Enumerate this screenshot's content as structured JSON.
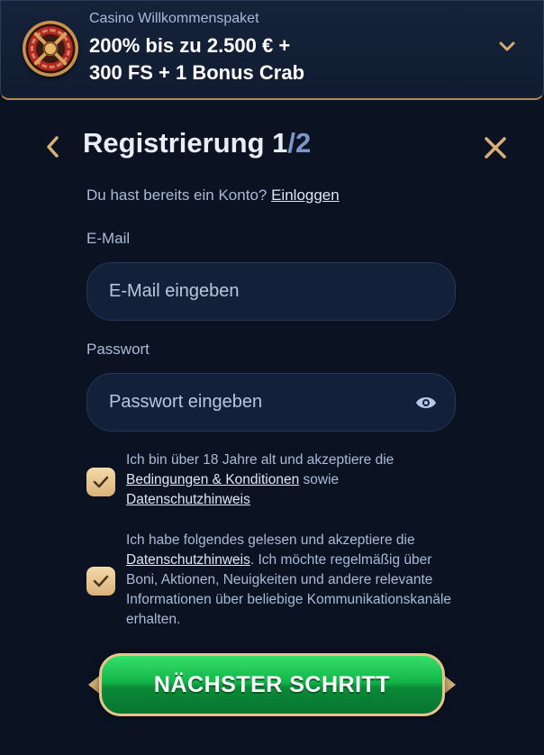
{
  "promo": {
    "kicker": "Casino Willkommenspaket",
    "title_line1": "200% bis zu 2.500 € +",
    "title_line2": "300 FS + 1 Bonus Crab"
  },
  "header": {
    "title": "Registrierung 1",
    "step_separator": "/",
    "step_total": "2"
  },
  "login": {
    "text": "Du hast bereits ein Konto?",
    "link": "Einloggen"
  },
  "email": {
    "label": "E-Mail",
    "placeholder": "E-Mail eingeben",
    "value": ""
  },
  "password": {
    "label": "Passwort",
    "placeholder": "Passwort eingeben",
    "value": ""
  },
  "consent1": {
    "checked": true,
    "text_a": "Ich bin über 18 Jahre alt und akzeptiere die",
    "link_terms": "Bedingungen & Konditionen",
    "text_b": "sowie",
    "link_privacy": "Datenschutzhinweis"
  },
  "consent2": {
    "checked": true,
    "text_a": "Ich habe folgendes gelesen und akzeptiere die",
    "link_privacy": "Datenschutzhinweis",
    "text_b": ". Ich möchte regelmäßig über Boni, Aktionen, Neuigkeiten und andere relevante Informationen über beliebige Kommunikationskanäle erhalten."
  },
  "next_button": {
    "label": "NÄCHSTER SCHRITT"
  },
  "colors": {
    "background": "#0b1322",
    "accent_gold": "#e6c48b",
    "button_green": "#13b64a"
  }
}
